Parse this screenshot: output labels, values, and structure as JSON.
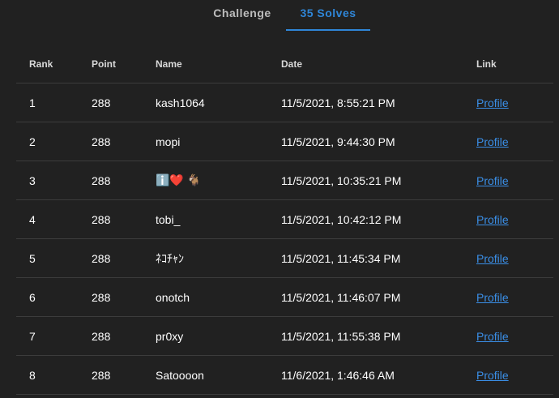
{
  "tabs": [
    {
      "label": "Challenge"
    },
    {
      "label": "35 Solves"
    }
  ],
  "table": {
    "headers": [
      "Rank",
      "Point",
      "Name",
      "Date",
      "Link"
    ],
    "rows": [
      {
        "rank": "1",
        "point": "288",
        "name": "kash1064",
        "date": "11/5/2021, 8:55:21 PM",
        "link": "Profile"
      },
      {
        "rank": "2",
        "point": "288",
        "name": "mopi",
        "date": "11/5/2021, 9:44:30 PM",
        "link": "Profile"
      },
      {
        "rank": "3",
        "point": "288",
        "name": "ℹ️❤️ 🐐",
        "date": "11/5/2021, 10:35:21 PM",
        "link": "Profile"
      },
      {
        "rank": "4",
        "point": "288",
        "name": "tobi_",
        "date": "11/5/2021, 10:42:12 PM",
        "link": "Profile"
      },
      {
        "rank": "5",
        "point": "288",
        "name": "ﾈｺﾁｬﾝ",
        "date": "11/5/2021, 11:45:34 PM",
        "link": "Profile"
      },
      {
        "rank": "6",
        "point": "288",
        "name": "onotch",
        "date": "11/5/2021, 11:46:07 PM",
        "link": "Profile"
      },
      {
        "rank": "7",
        "point": "288",
        "name": "pr0xy",
        "date": "11/5/2021, 11:55:38 PM",
        "link": "Profile"
      },
      {
        "rank": "8",
        "point": "288",
        "name": "Satoooon",
        "date": "11/6/2021, 1:46:46 AM",
        "link": "Profile"
      }
    ]
  }
}
